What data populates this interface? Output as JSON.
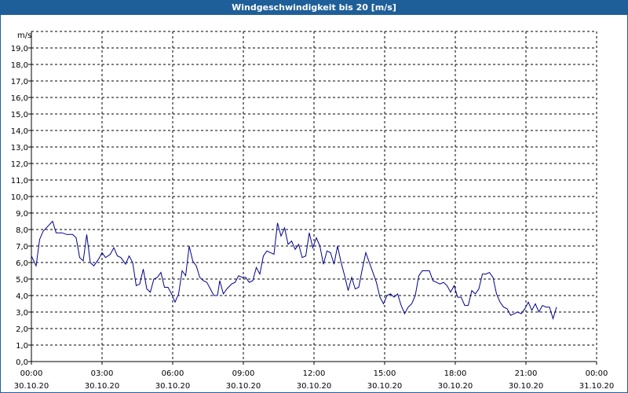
{
  "window": {
    "title": "Windgeschwindigkeit bis 20 [m/s]"
  },
  "colors": {
    "titlebar": "#1f5f99",
    "title_text": "#ffffff",
    "series": "#00008b",
    "grid": "#000000"
  },
  "chart_data": {
    "type": "line",
    "title": "Windgeschwindigkeit bis 20 [m/s]",
    "ylabel": "m/s",
    "xlabel": "",
    "ylim": [
      0,
      20
    ],
    "xlim": [
      0,
      24
    ],
    "grid": true,
    "y_ticks": [
      "0,0",
      "1,0",
      "2,0",
      "3,0",
      "4,0",
      "5,0",
      "6,0",
      "7,0",
      "8,0",
      "9,0",
      "10,0",
      "11,0",
      "12,0",
      "13,0",
      "14,0",
      "15,0",
      "16,0",
      "17,0",
      "18,0",
      "19,0"
    ],
    "x_ticks": [
      {
        "time": "00:00",
        "date": "30.10.20"
      },
      {
        "time": "03:00",
        "date": "30.10.20"
      },
      {
        "time": "06:00",
        "date": "30.10.20"
      },
      {
        "time": "09:00",
        "date": "30.10.20"
      },
      {
        "time": "12:00",
        "date": "30.10.20"
      },
      {
        "time": "15:00",
        "date": "30.10.20"
      },
      {
        "time": "18:00",
        "date": "30.10.20"
      },
      {
        "time": "21:00",
        "date": "30.10.20"
      },
      {
        "time": "00:00",
        "date": "31.10.20"
      }
    ],
    "series": [
      {
        "values": [
          [
            0.0,
            6.4
          ],
          [
            0.2,
            5.8
          ],
          [
            0.35,
            7.4
          ],
          [
            0.5,
            7.9
          ],
          [
            0.7,
            8.2
          ],
          [
            0.9,
            8.5
          ],
          [
            1.05,
            7.8
          ],
          [
            1.3,
            7.8
          ],
          [
            1.5,
            7.7
          ],
          [
            1.75,
            7.7
          ],
          [
            1.9,
            7.5
          ],
          [
            2.05,
            6.3
          ],
          [
            2.2,
            6.1
          ],
          [
            2.35,
            7.7
          ],
          [
            2.5,
            6.0
          ],
          [
            2.65,
            5.8
          ],
          [
            2.85,
            6.2
          ],
          [
            3.0,
            6.6
          ],
          [
            3.15,
            6.3
          ],
          [
            3.35,
            6.5
          ],
          [
            3.5,
            6.9
          ],
          [
            3.65,
            6.4
          ],
          [
            3.8,
            6.3
          ],
          [
            4.0,
            5.9
          ],
          [
            4.15,
            6.4
          ],
          [
            4.3,
            6.0
          ],
          [
            4.45,
            4.6
          ],
          [
            4.6,
            4.7
          ],
          [
            4.75,
            5.6
          ],
          [
            4.9,
            4.4
          ],
          [
            5.05,
            4.2
          ],
          [
            5.2,
            5.0
          ],
          [
            5.35,
            5.1
          ],
          [
            5.5,
            5.4
          ],
          [
            5.65,
            4.5
          ],
          [
            5.8,
            4.5
          ],
          [
            5.95,
            4.1
          ],
          [
            6.1,
            3.6
          ],
          [
            6.25,
            4.1
          ],
          [
            6.4,
            5.5
          ],
          [
            6.55,
            5.2
          ],
          [
            6.7,
            7.0
          ],
          [
            6.85,
            6.1
          ],
          [
            7.0,
            5.8
          ],
          [
            7.15,
            5.1
          ],
          [
            7.3,
            4.9
          ],
          [
            7.45,
            4.8
          ],
          [
            7.6,
            4.4
          ],
          [
            7.75,
            4.0
          ],
          [
            7.9,
            4.0
          ],
          [
            8.0,
            4.9
          ],
          [
            8.15,
            4.1
          ],
          [
            8.3,
            4.4
          ],
          [
            8.5,
            4.7
          ],
          [
            8.65,
            4.8
          ],
          [
            8.8,
            5.2
          ],
          [
            8.95,
            5.1
          ],
          [
            9.1,
            5.1
          ],
          [
            9.25,
            4.8
          ],
          [
            9.4,
            4.9
          ],
          [
            9.55,
            5.7
          ],
          [
            9.7,
            5.3
          ],
          [
            9.85,
            6.4
          ],
          [
            10.0,
            6.7
          ],
          [
            10.15,
            6.6
          ],
          [
            10.3,
            6.5
          ],
          [
            10.45,
            8.4
          ],
          [
            10.6,
            7.6
          ],
          [
            10.75,
            8.1
          ],
          [
            10.9,
            7.1
          ],
          [
            11.05,
            7.3
          ],
          [
            11.2,
            6.8
          ],
          [
            11.35,
            7.1
          ],
          [
            11.5,
            6.3
          ],
          [
            11.65,
            6.4
          ],
          [
            11.8,
            7.8
          ],
          [
            11.95,
            6.9
          ],
          [
            12.1,
            7.5
          ],
          [
            12.25,
            7.0
          ],
          [
            12.4,
            5.9
          ],
          [
            12.55,
            6.7
          ],
          [
            12.7,
            6.6
          ],
          [
            12.85,
            5.9
          ],
          [
            13.0,
            7.0
          ],
          [
            13.15,
            6.0
          ],
          [
            13.3,
            5.2
          ],
          [
            13.45,
            4.3
          ],
          [
            13.6,
            5.1
          ],
          [
            13.75,
            4.4
          ],
          [
            13.9,
            4.5
          ],
          [
            14.05,
            5.6
          ],
          [
            14.2,
            6.6
          ],
          [
            14.35,
            6.0
          ],
          [
            14.5,
            5.4
          ],
          [
            14.65,
            4.8
          ],
          [
            14.8,
            3.9
          ],
          [
            14.95,
            3.5
          ],
          [
            15.1,
            4.0
          ],
          [
            15.25,
            4.1
          ],
          [
            15.4,
            3.9
          ],
          [
            15.55,
            4.1
          ],
          [
            15.7,
            3.4
          ],
          [
            15.85,
            2.9
          ],
          [
            16.0,
            3.3
          ],
          [
            16.15,
            3.5
          ],
          [
            16.3,
            4.0
          ],
          [
            16.45,
            5.2
          ],
          [
            16.6,
            5.5
          ],
          [
            16.75,
            5.5
          ],
          [
            16.9,
            5.5
          ],
          [
            17.05,
            4.9
          ],
          [
            17.2,
            4.8
          ],
          [
            17.35,
            4.7
          ],
          [
            17.5,
            4.8
          ],
          [
            17.65,
            4.6
          ],
          [
            17.8,
            4.2
          ],
          [
            17.95,
            4.6
          ],
          [
            18.1,
            3.9
          ],
          [
            18.25,
            3.9
          ],
          [
            18.4,
            3.4
          ],
          [
            18.55,
            3.4
          ],
          [
            18.7,
            4.3
          ],
          [
            18.85,
            4.1
          ],
          [
            19.0,
            4.4
          ],
          [
            19.15,
            5.3
          ],
          [
            19.3,
            5.3
          ],
          [
            19.45,
            5.4
          ],
          [
            19.6,
            5.1
          ],
          [
            19.75,
            4.1
          ],
          [
            19.9,
            3.6
          ],
          [
            20.05,
            3.3
          ],
          [
            20.2,
            3.2
          ],
          [
            20.35,
            2.8
          ],
          [
            20.5,
            2.9
          ],
          [
            20.65,
            3.0
          ],
          [
            20.8,
            2.9
          ],
          [
            20.95,
            3.2
          ],
          [
            21.1,
            3.6
          ],
          [
            21.25,
            3.1
          ],
          [
            21.4,
            3.5
          ],
          [
            21.55,
            3.0
          ],
          [
            21.7,
            3.4
          ],
          [
            21.85,
            3.3
          ],
          [
            22.0,
            3.3
          ],
          [
            22.15,
            2.6
          ],
          [
            22.3,
            3.3
          ]
        ]
      }
    ]
  }
}
